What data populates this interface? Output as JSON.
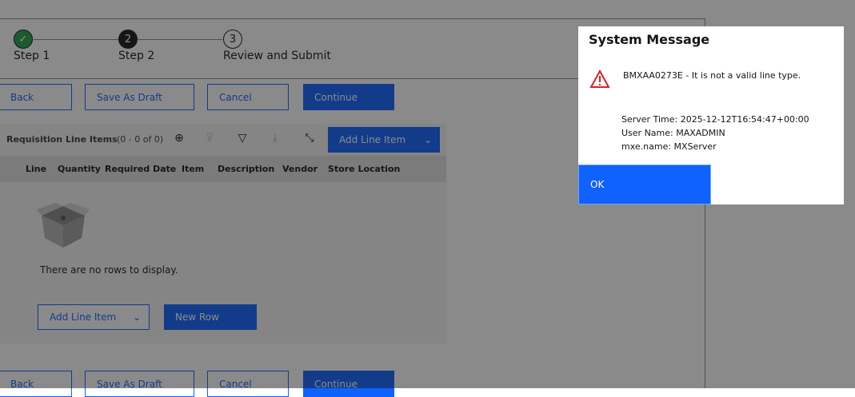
{
  "steps": [
    {
      "label": "Step 1",
      "number": "✓",
      "state": "complete"
    },
    {
      "label": "Step 2",
      "number": "2",
      "state": "current"
    },
    {
      "label": "Review and Submit",
      "number": "3",
      "state": "pending"
    }
  ],
  "actions": {
    "back": "Back",
    "save_draft": "Save As Draft",
    "cancel": "Cancel",
    "continue": "Continue"
  },
  "table": {
    "title": "Requisition Line Items",
    "count": "(0 - 0 of 0)",
    "add_line_item": "Add Line Item",
    "columns": [
      "Line",
      "Quantity",
      "Required Date",
      "Item",
      "Description",
      "Vendor",
      "Store Location"
    ],
    "empty_message": "There are no rows to display.",
    "new_row": "New Row"
  },
  "dialog": {
    "title": "System Message",
    "message": "BMXAA0273E - It is not a valid line type.",
    "details": [
      "Server Time: 2025-12-12T16:54:47+00:00",
      "User Name: MAXADMIN",
      "mxe.name: MXServer"
    ],
    "ok": "OK"
  },
  "colors": {
    "primary": "#0f62fe",
    "complete": "#24a148",
    "warning": "#da1e28"
  }
}
